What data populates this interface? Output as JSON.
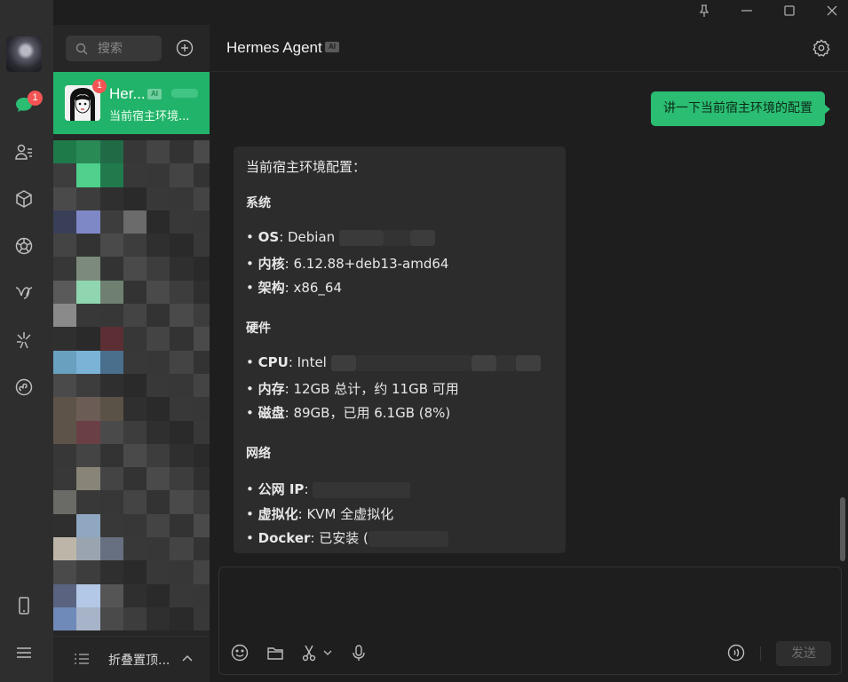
{
  "window": {
    "controls": [
      "pin-icon",
      "minimize-icon",
      "maximize-icon",
      "close-icon"
    ]
  },
  "rail": {
    "badge": "1",
    "icons": [
      "chat-icon",
      "contacts-icon",
      "box-icon",
      "moments-icon",
      "channels-icon",
      "sparkle-icon",
      "miniprogram-icon",
      "phone-icon",
      "menu-icon"
    ]
  },
  "list": {
    "search_placeholder": "搜索",
    "active_chat": {
      "name": "Her...",
      "ai_tag": "AI",
      "preview": "当前宿主环境...",
      "badge": "1"
    },
    "fold_label": "折叠置顶..."
  },
  "main": {
    "title": "Hermes Agent",
    "ai_tag": "AI",
    "outgoing": "讲一下当前宿主环境的配置",
    "reply": {
      "intro": "当前宿主环境配置：",
      "sections": [
        {
          "heading": "系统",
          "items": [
            {
              "key": "OS",
              "value": ": Debian "
            },
            {
              "key": "内核",
              "value": ": 6.12.88+deb13-amd64"
            },
            {
              "key": "架构",
              "value": ": x86_64"
            }
          ]
        },
        {
          "heading": "硬件",
          "items": [
            {
              "key": "CPU",
              "value": ": Intel "
            },
            {
              "key": "内存",
              "value": ": 12GB 总计，约 11GB 可用"
            },
            {
              "key": "磁盘",
              "value": ": 89GB，已用 6.1GB (8%)"
            }
          ]
        },
        {
          "heading": "网络",
          "items": [
            {
              "key": "公网 IP",
              "value": ": "
            },
            {
              "key": "虚拟化",
              "value": ": KVM 全虚拟化"
            },
            {
              "key": "Docker",
              "value": ": 已安装 ("
            }
          ]
        }
      ]
    },
    "send_label": "发送",
    "toolbar_icons": [
      "emoji-icon",
      "folder-icon",
      "scissors-icon",
      "mic-icon",
      "voice-call-icon"
    ]
  }
}
